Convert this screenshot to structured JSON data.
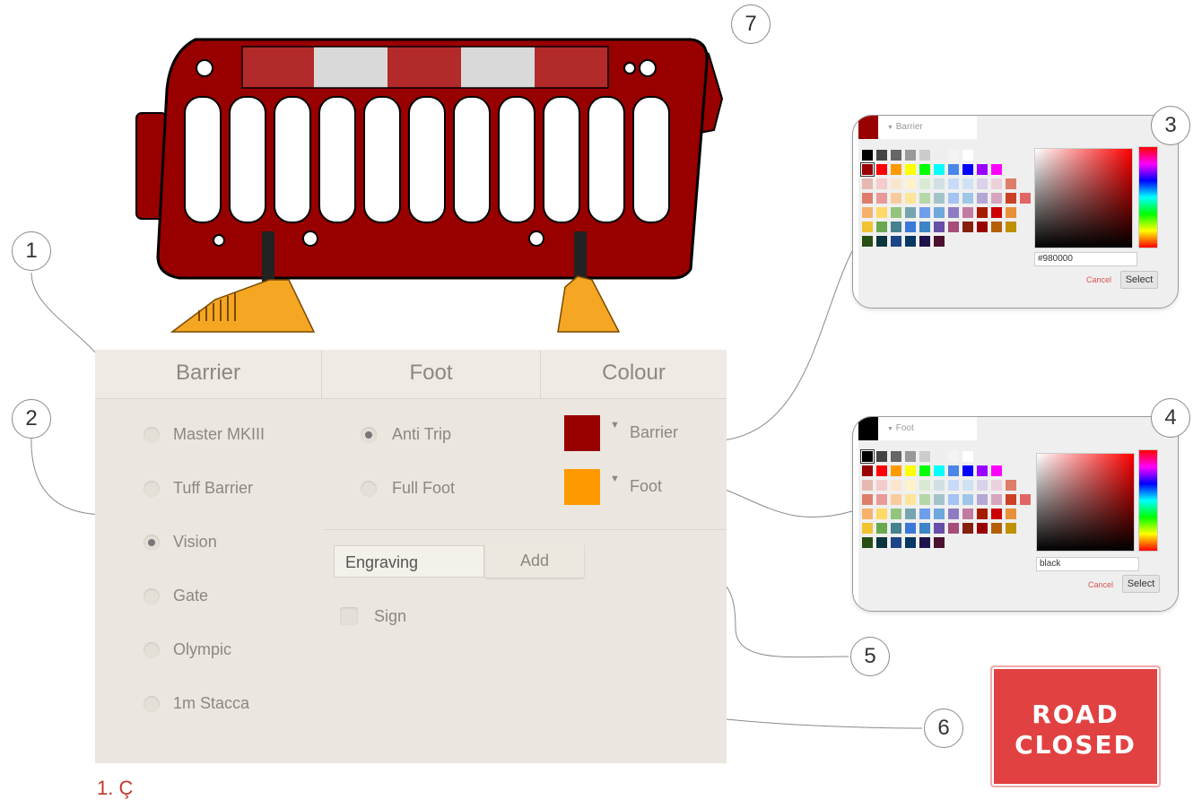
{
  "callouts": [
    "1",
    "2",
    "3",
    "4",
    "5",
    "6",
    "7"
  ],
  "headers": {
    "barrier": "Barrier",
    "foot": "Foot",
    "colour": "Colour"
  },
  "barrier_options": [
    {
      "label": "Master MKIII",
      "selected": false
    },
    {
      "label": "Tuff Barrier",
      "selected": false
    },
    {
      "label": "Vision",
      "selected": true
    },
    {
      "label": "Gate",
      "selected": false
    },
    {
      "label": "Olympic",
      "selected": false
    },
    {
      "label": "1m Stacca",
      "selected": false
    }
  ],
  "foot_options": [
    {
      "label": "Anti Trip",
      "selected": true
    },
    {
      "label": "Full Foot",
      "selected": false
    }
  ],
  "colour_options": [
    {
      "label": "Barrier",
      "color": "#980000"
    },
    {
      "label": "Foot",
      "color": "#ff9900"
    }
  ],
  "engraving": {
    "value": "Engraving",
    "add_label": "Add"
  },
  "sign": {
    "label": "Sign",
    "checked": false
  },
  "pickers": [
    {
      "tab_label": "Barrier",
      "selected_color": "#980000",
      "hex_value": "#980000",
      "cancel_label": "Cancel",
      "select_label": "Select",
      "gradient_hue": "#ff0000"
    },
    {
      "tab_label": "Foot",
      "selected_color": "#000000",
      "hex_value": "black",
      "cancel_label": "Cancel",
      "select_label": "Select",
      "gradient_hue": "#ff0000"
    }
  ],
  "palette_rows": [
    [
      "#000000",
      "#444444",
      "#666666",
      "#999999",
      "#cccccc",
      "#eeeeee",
      "#f3f3f3",
      "#ffffff"
    ],
    [
      "#980000",
      "#ff0000",
      "#ff9900",
      "#ffff00",
      "#00ff00",
      "#00ffff",
      "#4a86e8",
      "#0000ff",
      "#9900ff",
      "#ff00ff"
    ],
    [
      "#e6b8af",
      "#f4cccc",
      "#fce5cd",
      "#fff2cc",
      "#d9ead3",
      "#d0e0e3",
      "#c9daf8",
      "#cfe2f3",
      "#d9d2e9",
      "#ead1dc",
      "#dd7e6b"
    ],
    [
      "#dd7e6b",
      "#ea9999",
      "#f9cb9c",
      "#ffe599",
      "#b6d7a8",
      "#a2c4c9",
      "#a4c2f4",
      "#9fc5e8",
      "#b4a7d6",
      "#d5a6bd",
      "#cc4125",
      "#e06666"
    ],
    [
      "#f6b26b",
      "#ffd966",
      "#93c47d",
      "#76a5af",
      "#6d9eeb",
      "#6fa8dc",
      "#8e7cc3",
      "#c27ba0",
      "#a61c00",
      "#cc0000",
      "#e69138"
    ],
    [
      "#f1c232",
      "#6aa84f",
      "#45818e",
      "#3c78d8",
      "#3d85c6",
      "#674ea7",
      "#a64d79",
      "#85200c",
      "#990000",
      "#b45f06",
      "#bf9000"
    ],
    [
      "#274e13",
      "#0c343d",
      "#1c4587",
      "#073763",
      "#20124d",
      "#4c1130"
    ]
  ],
  "road_sign": {
    "line1": "ROAD",
    "line2": "CLOSED"
  },
  "caption": "1.    Ç                 "
}
